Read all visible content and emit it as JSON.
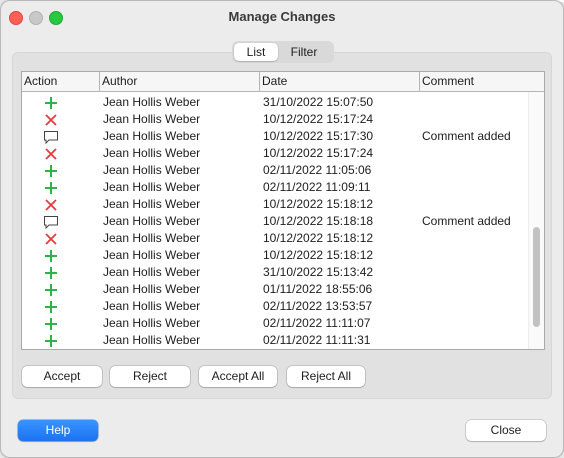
{
  "window": {
    "title": "Manage Changes"
  },
  "tabs": {
    "list_label": "List",
    "filter_label": "Filter",
    "active": "List"
  },
  "table": {
    "headers": {
      "action": "Action",
      "author": "Author",
      "date": "Date",
      "comment": "Comment"
    },
    "rows": [
      {
        "action": "insert",
        "author": "Jean Hollis Weber",
        "date": "31/10/2022 15:07:50",
        "comment": ""
      },
      {
        "action": "delete",
        "author": "Jean Hollis Weber",
        "date": "10/12/2022 15:17:24",
        "comment": ""
      },
      {
        "action": "comment",
        "author": "Jean Hollis Weber",
        "date": "10/12/2022 15:17:30",
        "comment": "Comment added"
      },
      {
        "action": "delete",
        "author": "Jean Hollis Weber",
        "date": "10/12/2022 15:17:24",
        "comment": ""
      },
      {
        "action": "insert",
        "author": "Jean Hollis Weber",
        "date": "02/11/2022 11:05:06",
        "comment": ""
      },
      {
        "action": "insert",
        "author": "Jean Hollis Weber",
        "date": "02/11/2022 11:09:11",
        "comment": ""
      },
      {
        "action": "delete",
        "author": "Jean Hollis Weber",
        "date": "10/12/2022 15:18:12",
        "comment": ""
      },
      {
        "action": "comment",
        "author": "Jean Hollis Weber",
        "date": "10/12/2022 15:18:18",
        "comment": "Comment added"
      },
      {
        "action": "delete",
        "author": "Jean Hollis Weber",
        "date": "10/12/2022 15:18:12",
        "comment": ""
      },
      {
        "action": "insert",
        "author": "Jean Hollis Weber",
        "date": "10/12/2022 15:18:12",
        "comment": ""
      },
      {
        "action": "insert",
        "author": "Jean Hollis Weber",
        "date": "31/10/2022 15:13:42",
        "comment": ""
      },
      {
        "action": "insert",
        "author": "Jean Hollis Weber",
        "date": "01/11/2022 18:55:06",
        "comment": ""
      },
      {
        "action": "insert",
        "author": "Jean Hollis Weber",
        "date": "02/11/2022 13:53:57",
        "comment": ""
      },
      {
        "action": "insert",
        "author": "Jean Hollis Weber",
        "date": "02/11/2022 11:11:07",
        "comment": ""
      },
      {
        "action": "insert",
        "author": "Jean Hollis Weber",
        "date": "02/11/2022 11:11:31",
        "comment": ""
      }
    ]
  },
  "buttons": {
    "accept": "Accept",
    "reject": "Reject",
    "accept_all": "Accept All",
    "reject_all": "Reject All",
    "help": "Help",
    "close": "Close"
  },
  "colors": {
    "insert": "#2fb24a",
    "delete": "#e23c3c",
    "comment": "#444444",
    "help_button": "#1a73f0"
  }
}
